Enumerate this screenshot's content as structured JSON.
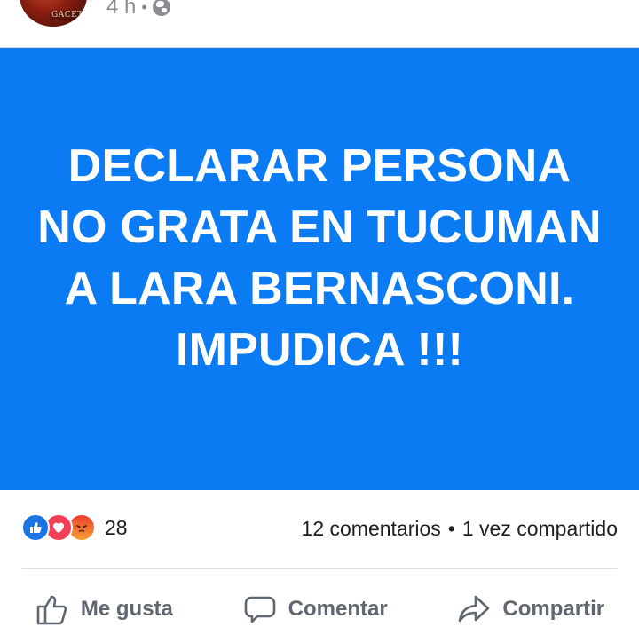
{
  "post": {
    "time": "4 h",
    "separator": "•",
    "privacy_icon": "globe-icon",
    "avatar_tag": "GACETA",
    "text": "DECLARAR PERSONA NO GRATA EN TUCUMAN A LARA BERNASCONI. IMPUDICA !!!",
    "background_color": "#0b7bf4"
  },
  "stats": {
    "reaction_icons": [
      "like-icon",
      "love-icon",
      "angry-icon"
    ],
    "reaction_count": "28",
    "comments": "12 comentarios",
    "separator": "•",
    "shares": "1 vez compartido"
  },
  "actions": {
    "like_label": "Me gusta",
    "comment_label": "Comentar",
    "share_label": "Compartir"
  }
}
